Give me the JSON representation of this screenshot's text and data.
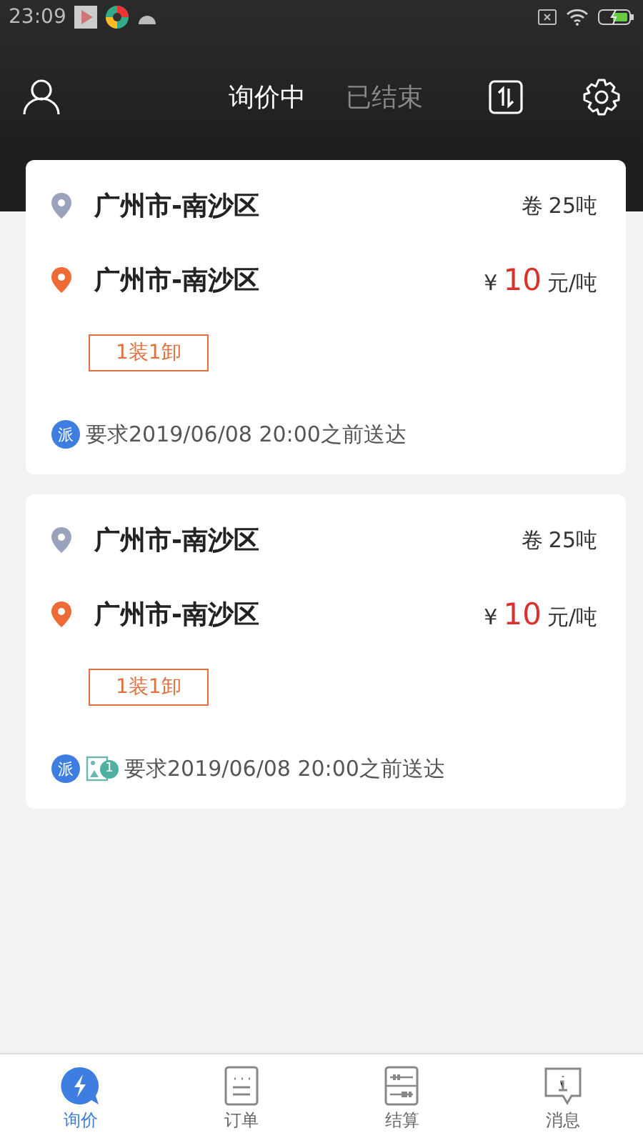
{
  "status_bar": {
    "time": "23:09"
  },
  "header": {
    "tabs": [
      {
        "label": "询价中",
        "selected": true
      },
      {
        "label": "已结束",
        "selected": false
      }
    ]
  },
  "cards": [
    {
      "origin": "广州市-南沙区",
      "destination": "广州市-南沙区",
      "cargo_type": "卷",
      "weight": "25吨",
      "currency": "¥",
      "price": "10",
      "unit": "元/吨",
      "tag": "1装1卸",
      "dispatch_badge": "派",
      "deadline": "要求2019/06/08 20:00之前送达"
    },
    {
      "origin": "广州市-南沙区",
      "destination": "广州市-南沙区",
      "cargo_type": "卷",
      "weight": "25吨",
      "currency": "¥",
      "price": "10",
      "unit": "元/吨",
      "tag": "1装1卸",
      "dispatch_badge": "派",
      "photo_count": "1",
      "deadline": "要求2019/06/08 20:00之前送达"
    }
  ],
  "bottom_nav": [
    {
      "kind": "inquiry",
      "label": "询价",
      "selected": true
    },
    {
      "kind": "orders",
      "label": "订单",
      "selected": false
    },
    {
      "kind": "settlement",
      "label": "结算",
      "selected": false
    },
    {
      "kind": "messages",
      "label": "消息",
      "selected": false
    }
  ]
}
